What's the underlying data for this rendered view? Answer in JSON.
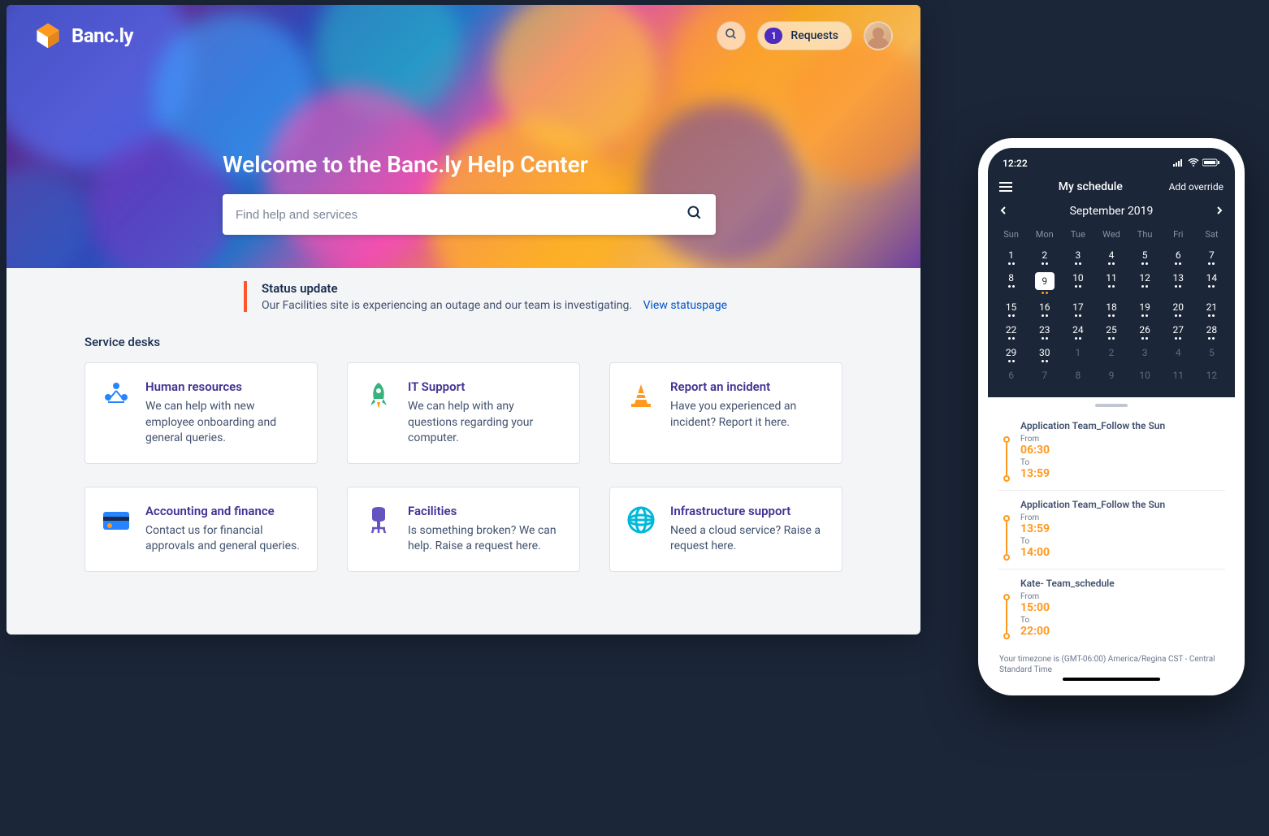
{
  "brand": {
    "name": "Banc.ly"
  },
  "topbar": {
    "requests_label": "Requests",
    "requests_count": "1"
  },
  "hero": {
    "title": "Welcome to the Banc.ly Help Center",
    "search_placeholder": "Find help and services"
  },
  "status": {
    "title": "Status update",
    "body": "Our Facilities site is experiencing an outage and our team is investigating.",
    "link": "View statuspage"
  },
  "desks": {
    "heading": "Service desks",
    "items": [
      {
        "title": "Human resources",
        "desc": "We can help with new employee onboarding and general queries."
      },
      {
        "title": "IT Support",
        "desc": "We can help with any questions regarding your computer."
      },
      {
        "title": "Report an incident",
        "desc": "Have you experienced an incident? Report it here."
      },
      {
        "title": "Accounting and finance",
        "desc": "Contact us for financial approvals and general queries."
      },
      {
        "title": "Facilities",
        "desc": "Is something broken? We can help. Raise a request here."
      },
      {
        "title": "Infrastructure support",
        "desc": "Need a cloud service? Raise a request here."
      }
    ]
  },
  "phone": {
    "time": "12:22",
    "header_title": "My schedule",
    "add_override": "Add override",
    "month": "September 2019",
    "dow": [
      "Sun",
      "Mon",
      "Tue",
      "Wed",
      "Thu",
      "Fri",
      "Sat"
    ],
    "weeks": [
      [
        "1",
        "2",
        "3",
        "4",
        "5",
        "6",
        "7"
      ],
      [
        "8",
        "9",
        "10",
        "11",
        "12",
        "13",
        "14"
      ],
      [
        "15",
        "16",
        "17",
        "18",
        "19",
        "20",
        "21"
      ],
      [
        "22",
        "23",
        "24",
        "25",
        "26",
        "27",
        "28"
      ],
      [
        "29",
        "30",
        "1",
        "2",
        "3",
        "4",
        "5"
      ],
      [
        "6",
        "7",
        "8",
        "9",
        "10",
        "11",
        "12"
      ]
    ],
    "selected_day": "9",
    "schedule": [
      {
        "name": "Application Team_Follow the Sun",
        "from_label": "From",
        "from": "06:30",
        "to_label": "To",
        "to": "13:59"
      },
      {
        "name": "Application Team_Follow the Sun",
        "from_label": "From",
        "from": "13:59",
        "to_label": "To",
        "to": "14:00"
      },
      {
        "name": "Kate- Team_schedule",
        "from_label": "From",
        "from": "15:00",
        "to_label": "To",
        "to": "22:00"
      }
    ],
    "timezone": "Your timezone is (GMT-06:00) America/Regina CST - Central Standard Time"
  }
}
